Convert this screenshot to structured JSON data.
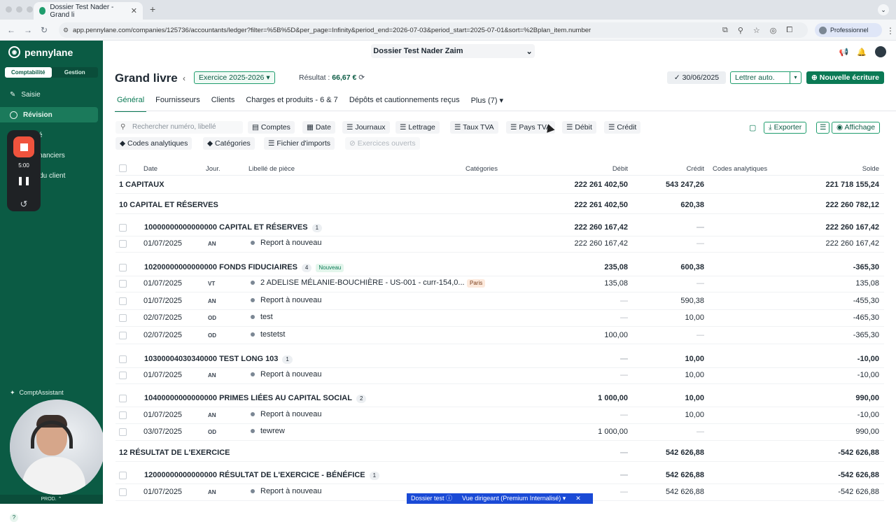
{
  "browser": {
    "tab_title": "Dossier Test Nader - Grand li",
    "url": "app.pennylane.com/companies/125736/accountants/ledger?filter=%5B%5D&per_page=Infinity&period_end=2026-07-03&period_start=2025-07-01&sort=%2Bplan_item.number",
    "profile": "Professionnel"
  },
  "sidebar": {
    "brand": "pennylane",
    "modes": [
      "Comptabilité",
      "Gestion"
    ],
    "items": [
      {
        "label": "Saisie",
        "icon": "pencil-icon"
      },
      {
        "label": "Révision",
        "icon": "check-circle-icon"
      },
      {
        "label": "ité",
        "icon": "dot-icon"
      },
      {
        "label": "financiers",
        "icon": "dot-icon"
      },
      {
        "label": "r du client",
        "icon": "dot-icon"
      }
    ],
    "timer": "5:00",
    "assistant": "ComptAssistant",
    "env": "PROD."
  },
  "header": {
    "dossier": "Dossier Test Nader Zaim",
    "title": "Grand livre",
    "exercise": "Exercice 2025-2026",
    "resultat_label": "Résultat :",
    "resultat_value": "66,67 €",
    "date": "30/06/2025",
    "lettrer": "Lettrer auto.",
    "new_entry": "Nouvelle écriture"
  },
  "tabs": [
    "Général",
    "Fournisseurs",
    "Clients",
    "Charges et produits - 6 & 7",
    "Dépôts et cautionnements reçus",
    "Plus (7)"
  ],
  "filters": {
    "search_placeholder": "Rechercher numéro, libellé",
    "row1": [
      "Comptes",
      "Date",
      "Journaux",
      "Lettrage",
      "Taux TVA",
      "Pays TVA",
      "Débit",
      "Crédit"
    ],
    "row2": [
      "Codes analytiques",
      "Catégories",
      "Fichier d'imports",
      "Exercices ouverts"
    ],
    "export": "Exporter",
    "display": "Affichage"
  },
  "table": {
    "headers": [
      "Date",
      "Jour.",
      "Libellé de pièce",
      "Catégories",
      "Débit",
      "Crédit",
      "Codes analytiques",
      "Solde"
    ],
    "rows": [
      {
        "kind": "class",
        "label": "1  CAPITAUX",
        "debit": "222 261 402,50",
        "credit": "543 247,26",
        "solde": "221 718 155,24"
      },
      {
        "kind": "class",
        "label": "10  CAPITAL ET RÉSERVES",
        "debit": "222 261 402,50",
        "credit": "620,38",
        "solde": "222 260 782,12"
      },
      {
        "kind": "account",
        "number": "10000000000000000",
        "label": "CAPITAL ET RÉSERVES",
        "count": "1",
        "badge": "",
        "debit": "222 260 167,42",
        "credit": "—",
        "solde": "222 260 167,42"
      },
      {
        "kind": "entry",
        "date": "01/07/2025",
        "jour": "AN",
        "label": "Report à nouveau",
        "cat": "",
        "debit": "222 260 167,42",
        "credit": "—",
        "solde": "222 260 167,42"
      },
      {
        "kind": "account",
        "number": "10200000000000000",
        "label": "FONDS FIDUCIAIRES",
        "count": "4",
        "badge": "Nouveau",
        "debit": "235,08",
        "credit": "600,38",
        "solde": "-365,30"
      },
      {
        "kind": "entry",
        "date": "01/07/2025",
        "jour": "VT",
        "label": "2 ADELISE MÉLANIE-BOUCHIÈRE - US-001 - curr-154,0...",
        "cat": "Paris",
        "debit": "135,08",
        "credit": "—",
        "solde": "135,08"
      },
      {
        "kind": "entry",
        "date": "01/07/2025",
        "jour": "AN",
        "label": "Report à nouveau",
        "cat": "",
        "debit": "—",
        "credit": "590,38",
        "solde": "-455,30"
      },
      {
        "kind": "entry",
        "date": "02/07/2025",
        "jour": "OD",
        "label": "test",
        "cat": "",
        "debit": "—",
        "credit": "10,00",
        "solde": "-465,30"
      },
      {
        "kind": "entry",
        "date": "02/07/2025",
        "jour": "OD",
        "label": "testetst",
        "cat": "",
        "debit": "100,00",
        "credit": "—",
        "solde": "-365,30"
      },
      {
        "kind": "account",
        "number": "10300004030340000",
        "label": "TEST LONG 103",
        "count": "1",
        "badge": "",
        "debit": "—",
        "credit": "10,00",
        "solde": "-10,00"
      },
      {
        "kind": "entry",
        "date": "01/07/2025",
        "jour": "AN",
        "label": "Report à nouveau",
        "cat": "",
        "debit": "—",
        "credit": "10,00",
        "solde": "-10,00"
      },
      {
        "kind": "account",
        "number": "10400000000000000",
        "label": "PRIMES LIÉES AU CAPITAL SOCIAL",
        "count": "2",
        "badge": "",
        "debit": "1 000,00",
        "credit": "10,00",
        "solde": "990,00"
      },
      {
        "kind": "entry",
        "date": "01/07/2025",
        "jour": "AN",
        "label": "Report à nouveau",
        "cat": "",
        "debit": "—",
        "credit": "10,00",
        "solde": "-10,00"
      },
      {
        "kind": "entry",
        "date": "03/07/2025",
        "jour": "OD",
        "label": "tewrew",
        "cat": "",
        "debit": "1 000,00",
        "credit": "—",
        "solde": "990,00"
      },
      {
        "kind": "class",
        "label": "12  RÉSULTAT DE L'EXERCICE",
        "debit": "—",
        "credit": "542 626,88",
        "solde": "-542 626,88"
      },
      {
        "kind": "account",
        "number": "12000000000000000",
        "label": "RÉSULTAT DE L'EXERCICE - BÉNÉFICE",
        "count": "1",
        "badge": "",
        "debit": "—",
        "credit": "542 626,88",
        "solde": "-542 626,88"
      },
      {
        "kind": "entry",
        "date": "01/07/2025",
        "jour": "AN",
        "label": "Report à nouveau",
        "cat": "",
        "debit": "—",
        "credit": "542 626,88",
        "solde": "-542 626,88"
      }
    ]
  },
  "footer": {
    "env": "Dossier test",
    "view": "Vue dirigeant (Premium Internalisé)"
  }
}
